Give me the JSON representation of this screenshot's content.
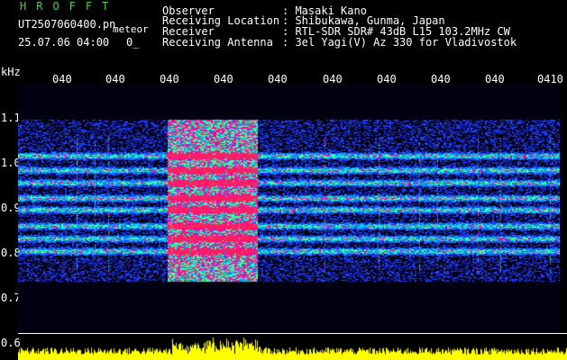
{
  "header": {
    "title": "HROFFT",
    "file": "UT2507060400.pn",
    "sub": "meteor",
    "date": "25.07.06 04:00",
    "zero": "0_",
    "fields": [
      {
        "label": "Observer",
        "value": ": Masaki Kano"
      },
      {
        "label": "Receiving Location",
        "value": ": Shibukawa, Gunma, Japan"
      },
      {
        "label": "Receiver",
        "value": ": RTL-SDR SDR# 43dB L15 103.2MHz CW"
      },
      {
        "label": "Receiving Antenna",
        "value": ": 3el Yagi(V) Az 330 for Vladivostok"
      }
    ]
  },
  "axis": {
    "unit": "kHz",
    "yticks": [
      "1.1",
      "1.0",
      "0.9",
      "0.8",
      "0.7",
      "0.6"
    ],
    "xticks": [
      "040",
      "040",
      "040",
      "040",
      "040",
      "040",
      "040",
      "040",
      "040",
      "0410"
    ]
  },
  "colors": {
    "background": "#000000",
    "title": "#4ccc4c",
    "tick": "#ffff00",
    "amplitude": "#ffff00"
  }
}
